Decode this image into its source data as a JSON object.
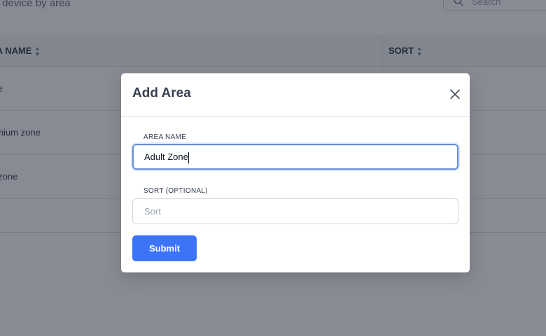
{
  "page": {
    "subtitle": "r device by area",
    "search_placeholder": "Search"
  },
  "table": {
    "columns": [
      {
        "label": "EA NAME"
      },
      {
        "label": "SORT"
      }
    ],
    "rows": [
      {
        "area_name": "ice"
      },
      {
        "area_name": "emium zone"
      },
      {
        "area_name": "s zone"
      }
    ]
  },
  "modal": {
    "title": "Add Area",
    "area_name_label": "AREA NAME",
    "area_name_value": "Adult Zone",
    "sort_label": "SORT (OPTIONAL)",
    "sort_placeholder": "Sort",
    "submit_label": "Submit"
  },
  "icons": {
    "search": "search-icon",
    "close": "close-icon",
    "sort": "sort-icon"
  },
  "colors": {
    "accent": "#3b74f7",
    "overlay": "rgba(17, 24, 39, 0.5)"
  }
}
